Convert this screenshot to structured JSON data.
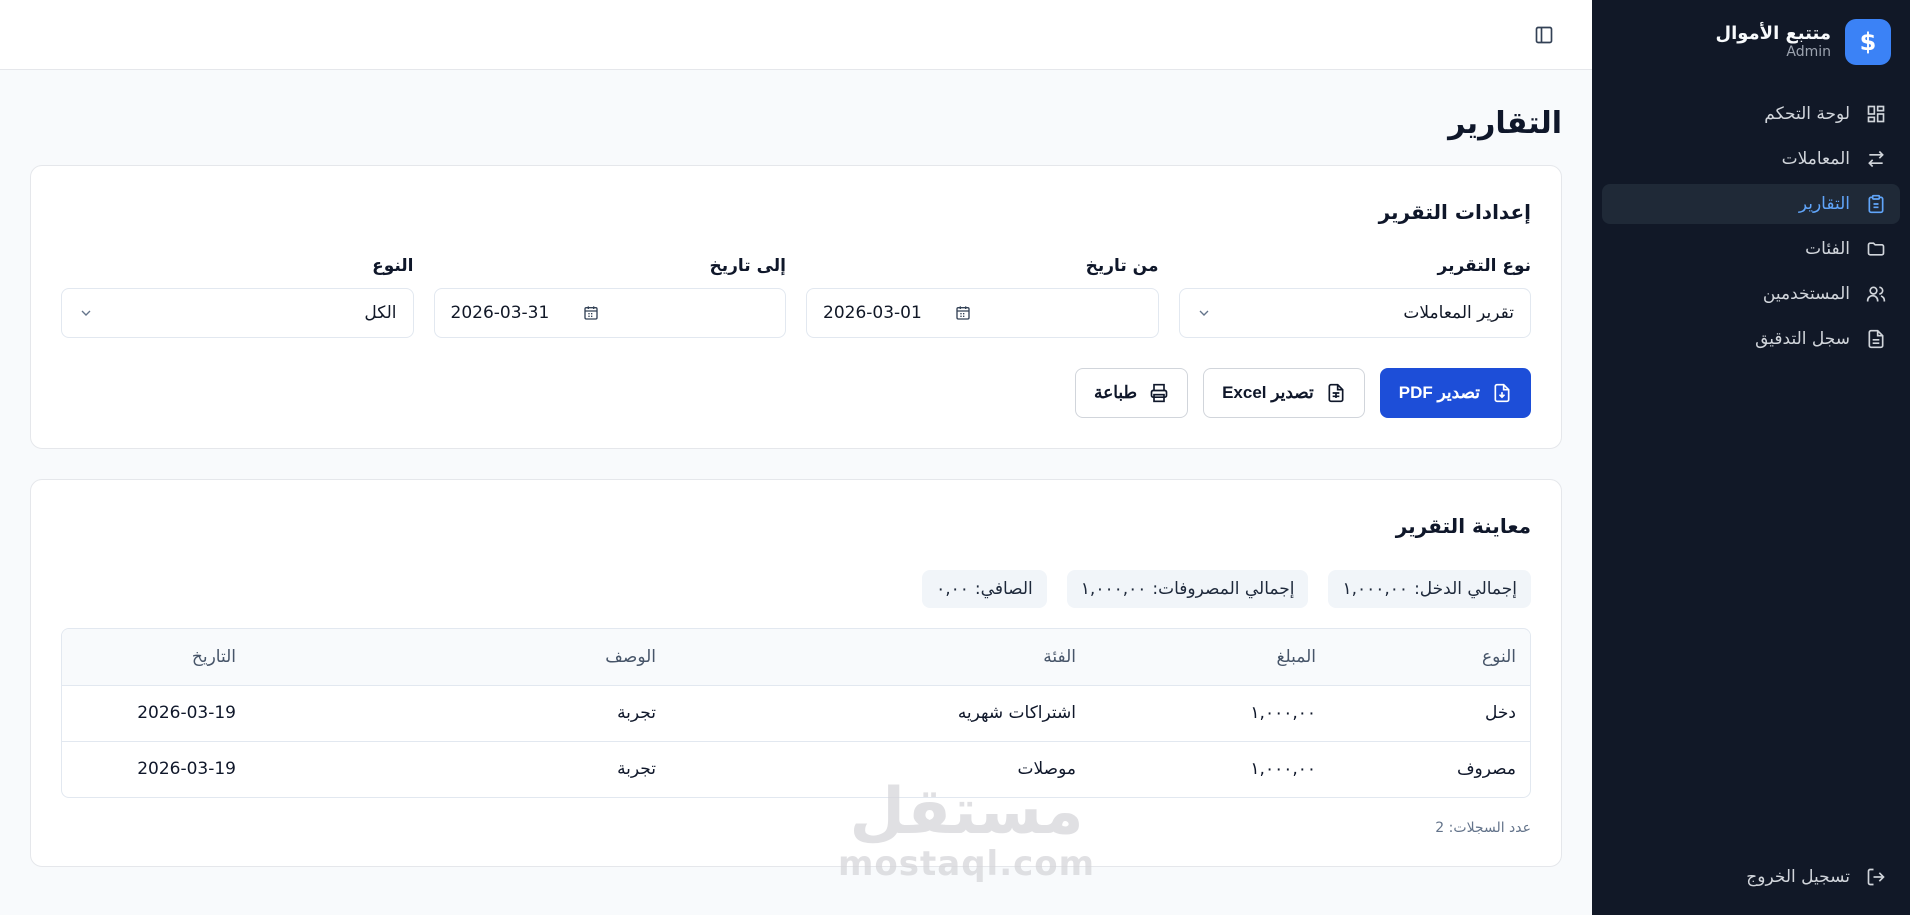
{
  "brand": {
    "title": "متتبع الأموال",
    "subtitle": "Admin",
    "logo_icon": "dollar-icon"
  },
  "nav": [
    {
      "label": "لوحة التحكم",
      "icon": "dashboard-icon",
      "active": false
    },
    {
      "label": "المعاملات",
      "icon": "arrows-icon",
      "active": false
    },
    {
      "label": "التقارير",
      "icon": "clipboard-icon",
      "active": true
    },
    {
      "label": "الفئات",
      "icon": "folder-icon",
      "active": false
    },
    {
      "label": "المستخدمين",
      "icon": "users-icon",
      "active": false
    },
    {
      "label": "سجل التدقيق",
      "icon": "file-icon",
      "active": false
    }
  ],
  "logout_label": "تسجيل الخروج",
  "page_title": "التقارير",
  "settings": {
    "title": "إعدادات التقرير",
    "report_type": {
      "label": "نوع التقرير",
      "value": "تقرير المعاملات"
    },
    "from_date": {
      "label": "من تاريخ",
      "value": "2026-03-01"
    },
    "to_date": {
      "label": "إلى تاريخ",
      "value": "2026-03-31"
    },
    "type": {
      "label": "النوع",
      "value": "الكل"
    },
    "buttons": {
      "pdf": "تصدير PDF",
      "excel": "تصدير Excel",
      "print": "طباعة"
    }
  },
  "preview": {
    "title": "معاينة التقرير",
    "summary": {
      "income_label": "إجمالي الدخل:",
      "income_value": "١,٠٠٠,٠٠",
      "expense_label": "إجمالي المصروفات:",
      "expense_value": "١,٠٠٠,٠٠",
      "net_label": "الصافي:",
      "net_value": "٠,٠٠"
    },
    "columns": [
      "النوع",
      "المبلغ",
      "الفئة",
      "الوصف",
      "التاريخ"
    ],
    "rows": [
      [
        "دخل",
        "١,٠٠٠,٠٠",
        "اشتراكات شهريه",
        "تجربة",
        "2026-03-19"
      ],
      [
        "مصروف",
        "١,٠٠٠,٠٠",
        "موصلات",
        "تجربة",
        "2026-03-19"
      ]
    ],
    "record_count": "عدد السجلات: 2"
  },
  "watermark": {
    "ar": "مستقل",
    "en": "mostaql.com"
  },
  "colors": {
    "sidebar_bg": "#111827",
    "accent": "#1d4ed8",
    "active_nav": "#60a5fa"
  }
}
